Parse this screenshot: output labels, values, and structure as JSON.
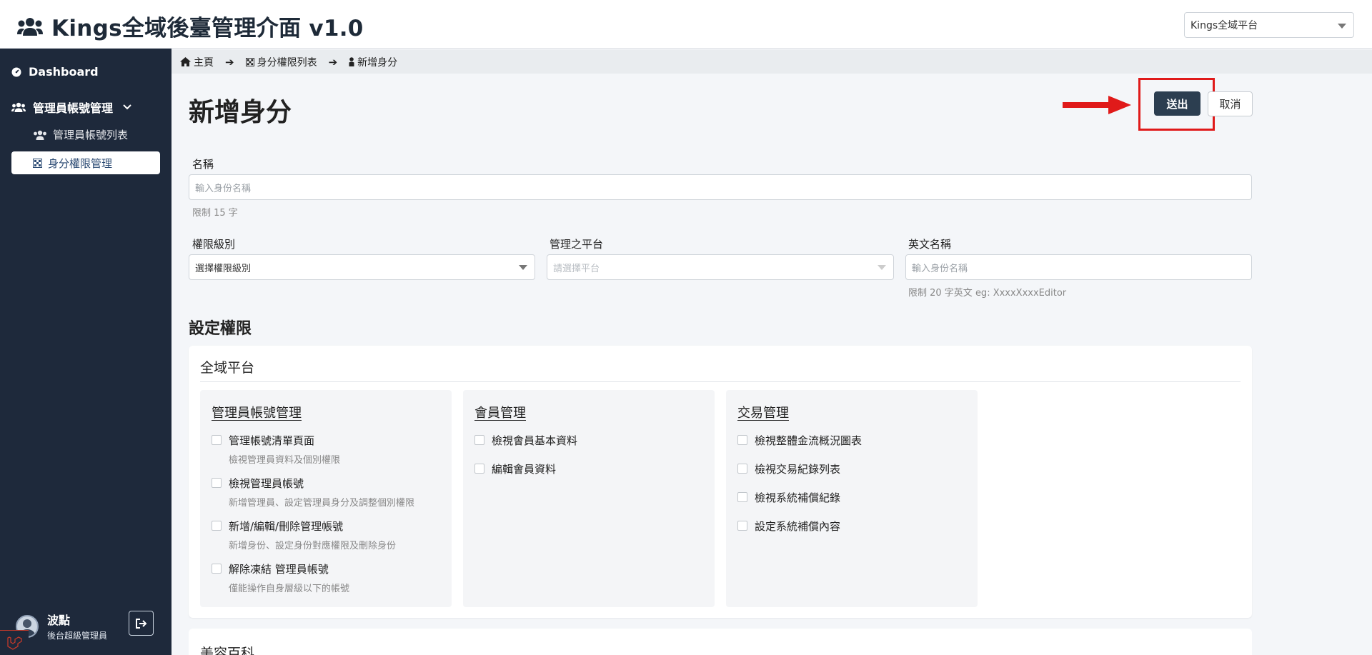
{
  "header": {
    "app_title": "Kings全域後臺管理介面 v1.0",
    "platform_selected": "Kings全域平台"
  },
  "sidebar": {
    "dashboard": "Dashboard",
    "admin_group": "管理員帳號管理",
    "admin_list": "管理員帳號列表",
    "role_mgmt": "身分權限管理",
    "user_name": "波點",
    "user_role": "後台超級管理員"
  },
  "breadcrumb": {
    "home": "主頁",
    "role_list": "身分權限列表",
    "add_role": "新增身分"
  },
  "page": {
    "title": "新增身分",
    "submit": "送出",
    "cancel": "取消"
  },
  "form": {
    "name_label": "名稱",
    "name_placeholder": "輸入身份名稱",
    "name_hint": "限制 15 字",
    "level_label": "權限級別",
    "level_value": "選擇權限級別",
    "platform_label": "管理之平台",
    "platform_placeholder": "請選擇平台",
    "en_name_label": "英文名稱",
    "en_name_placeholder": "輸入身份名稱",
    "en_name_hint": "限制 20 字英文 eg: XxxxXxxxEditor"
  },
  "permissions": {
    "section_title": "設定權限",
    "card_title": "全域平台",
    "groups": [
      {
        "title": "管理員帳號管理",
        "items": [
          {
            "label": "管理帳號清單頁面",
            "desc": "檢視管理員資料及個別權限"
          },
          {
            "label": "檢視管理員帳號",
            "desc": "新增管理員、設定管理員身分及調整個別權限"
          },
          {
            "label": "新增/編輯/刪除管理帳號",
            "desc": "新增身份、設定身份對應權限及刪除身份"
          },
          {
            "label": "解除凍結 管理員帳號",
            "desc": "僅能操作自身層級以下的帳號"
          }
        ]
      },
      {
        "title": "會員管理",
        "items": [
          {
            "label": "檢視會員基本資料"
          },
          {
            "label": "編輯會員資料"
          }
        ]
      },
      {
        "title": "交易管理",
        "items": [
          {
            "label": "檢視整體金流概況圖表"
          },
          {
            "label": "檢視交易紀錄列表"
          },
          {
            "label": "檢視系統補償紀錄"
          },
          {
            "label": "設定系統補償內容"
          }
        ]
      }
    ],
    "next_card_title": "美容百科"
  },
  "colors": {
    "sidebar_bg": "#1e293b",
    "submit_bg": "#2c3e50",
    "highlight": "#e01a1a"
  }
}
